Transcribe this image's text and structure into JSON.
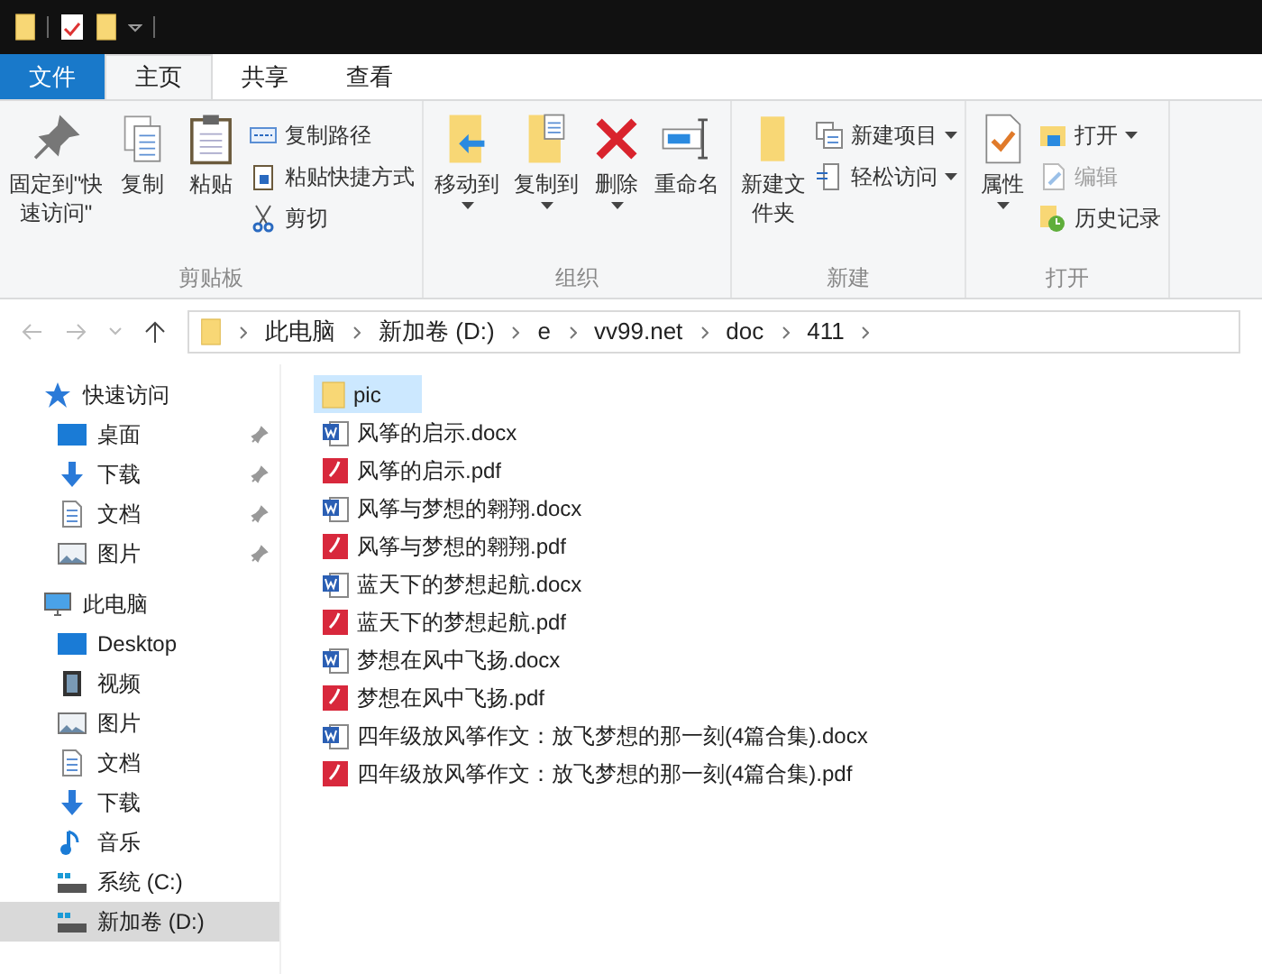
{
  "ribbon_tabs": [
    {
      "label": "文件",
      "kind": "file",
      "selected": false
    },
    {
      "label": "主页",
      "kind": "tab",
      "selected": true
    },
    {
      "label": "共享",
      "kind": "tab",
      "selected": false
    },
    {
      "label": "查看",
      "kind": "tab",
      "selected": false
    }
  ],
  "ribbon_groups": [
    {
      "label": "剪贴板",
      "large": [
        {
          "label": "固定到\"快速访问\"",
          "menu": false
        },
        {
          "label": "复制",
          "menu": false
        },
        {
          "label": "粘贴",
          "menu": false
        }
      ],
      "small": [
        {
          "label": "复制路径",
          "menu": false,
          "disabled": false
        },
        {
          "label": "粘贴快捷方式",
          "menu": false,
          "disabled": false
        },
        {
          "label": "剪切",
          "menu": false,
          "disabled": false
        }
      ]
    },
    {
      "label": "组织",
      "large": [
        {
          "label": "移动到",
          "menu": true
        },
        {
          "label": "复制到",
          "menu": true
        },
        {
          "label": "删除",
          "menu": true
        },
        {
          "label": "重命名",
          "menu": false
        }
      ]
    },
    {
      "label": "新建",
      "large": [
        {
          "label": "新建文件夹",
          "menu": false
        }
      ],
      "small": [
        {
          "label": "新建项目",
          "menu": true,
          "disabled": false
        },
        {
          "label": "轻松访问",
          "menu": true,
          "disabled": false
        }
      ]
    },
    {
      "label": "打开",
      "large": [
        {
          "label": "属性",
          "menu": true
        }
      ],
      "small": [
        {
          "label": "打开",
          "menu": true,
          "disabled": false
        },
        {
          "label": "编辑",
          "menu": false,
          "disabled": true
        },
        {
          "label": "历史记录",
          "menu": false,
          "disabled": false
        }
      ]
    }
  ],
  "address_bar": {
    "path": [
      "此电脑",
      "新加卷 (D:)",
      "e",
      "vv99.net",
      "doc",
      "411"
    ]
  },
  "sidebar": {
    "items": [
      {
        "label": "快速访问",
        "kind": "star",
        "selected": false,
        "children": [
          {
            "label": "桌面",
            "kind": "desktop",
            "pinned": true,
            "selected": false
          },
          {
            "label": "下载",
            "kind": "download",
            "pinned": true,
            "selected": false
          },
          {
            "label": "文档",
            "kind": "document",
            "pinned": true,
            "selected": false
          },
          {
            "label": "图片",
            "kind": "image",
            "pinned": true,
            "selected": false
          }
        ]
      },
      {
        "label": "此电脑",
        "kind": "pc",
        "selected": false,
        "children": [
          {
            "label": "Desktop",
            "kind": "desktop",
            "pinned": false,
            "selected": false
          },
          {
            "label": "视频",
            "kind": "video",
            "pinned": false,
            "selected": false
          },
          {
            "label": "图片",
            "kind": "image",
            "pinned": false,
            "selected": false
          },
          {
            "label": "文档",
            "kind": "document",
            "pinned": false,
            "selected": false
          },
          {
            "label": "下载",
            "kind": "download",
            "pinned": false,
            "selected": false
          },
          {
            "label": "音乐",
            "kind": "music",
            "pinned": false,
            "selected": false
          },
          {
            "label": "系统 (C:)",
            "kind": "drive",
            "pinned": false,
            "selected": false
          },
          {
            "label": "新加卷 (D:)",
            "kind": "drive",
            "pinned": false,
            "selected": true
          }
        ]
      }
    ]
  },
  "files": [
    {
      "name": "pic",
      "kind": "folder",
      "selected": true
    },
    {
      "name": "风筝的启示.docx",
      "kind": "word",
      "selected": false
    },
    {
      "name": "风筝的启示.pdf",
      "kind": "pdf",
      "selected": false
    },
    {
      "name": "风筝与梦想的翱翔.docx",
      "kind": "word",
      "selected": false
    },
    {
      "name": "风筝与梦想的翱翔.pdf",
      "kind": "pdf",
      "selected": false
    },
    {
      "name": "蓝天下的梦想起航.docx",
      "kind": "word",
      "selected": false
    },
    {
      "name": "蓝天下的梦想起航.pdf",
      "kind": "pdf",
      "selected": false
    },
    {
      "name": "梦想在风中飞扬.docx",
      "kind": "word",
      "selected": false
    },
    {
      "name": "梦想在风中飞扬.pdf",
      "kind": "pdf",
      "selected": false
    },
    {
      "name": "四年级放风筝作文：放飞梦想的那一刻(4篇合集).docx",
      "kind": "word",
      "selected": false
    },
    {
      "name": "四年级放风筝作文：放飞梦想的那一刻(4篇合集).pdf",
      "kind": "pdf",
      "selected": false
    }
  ]
}
